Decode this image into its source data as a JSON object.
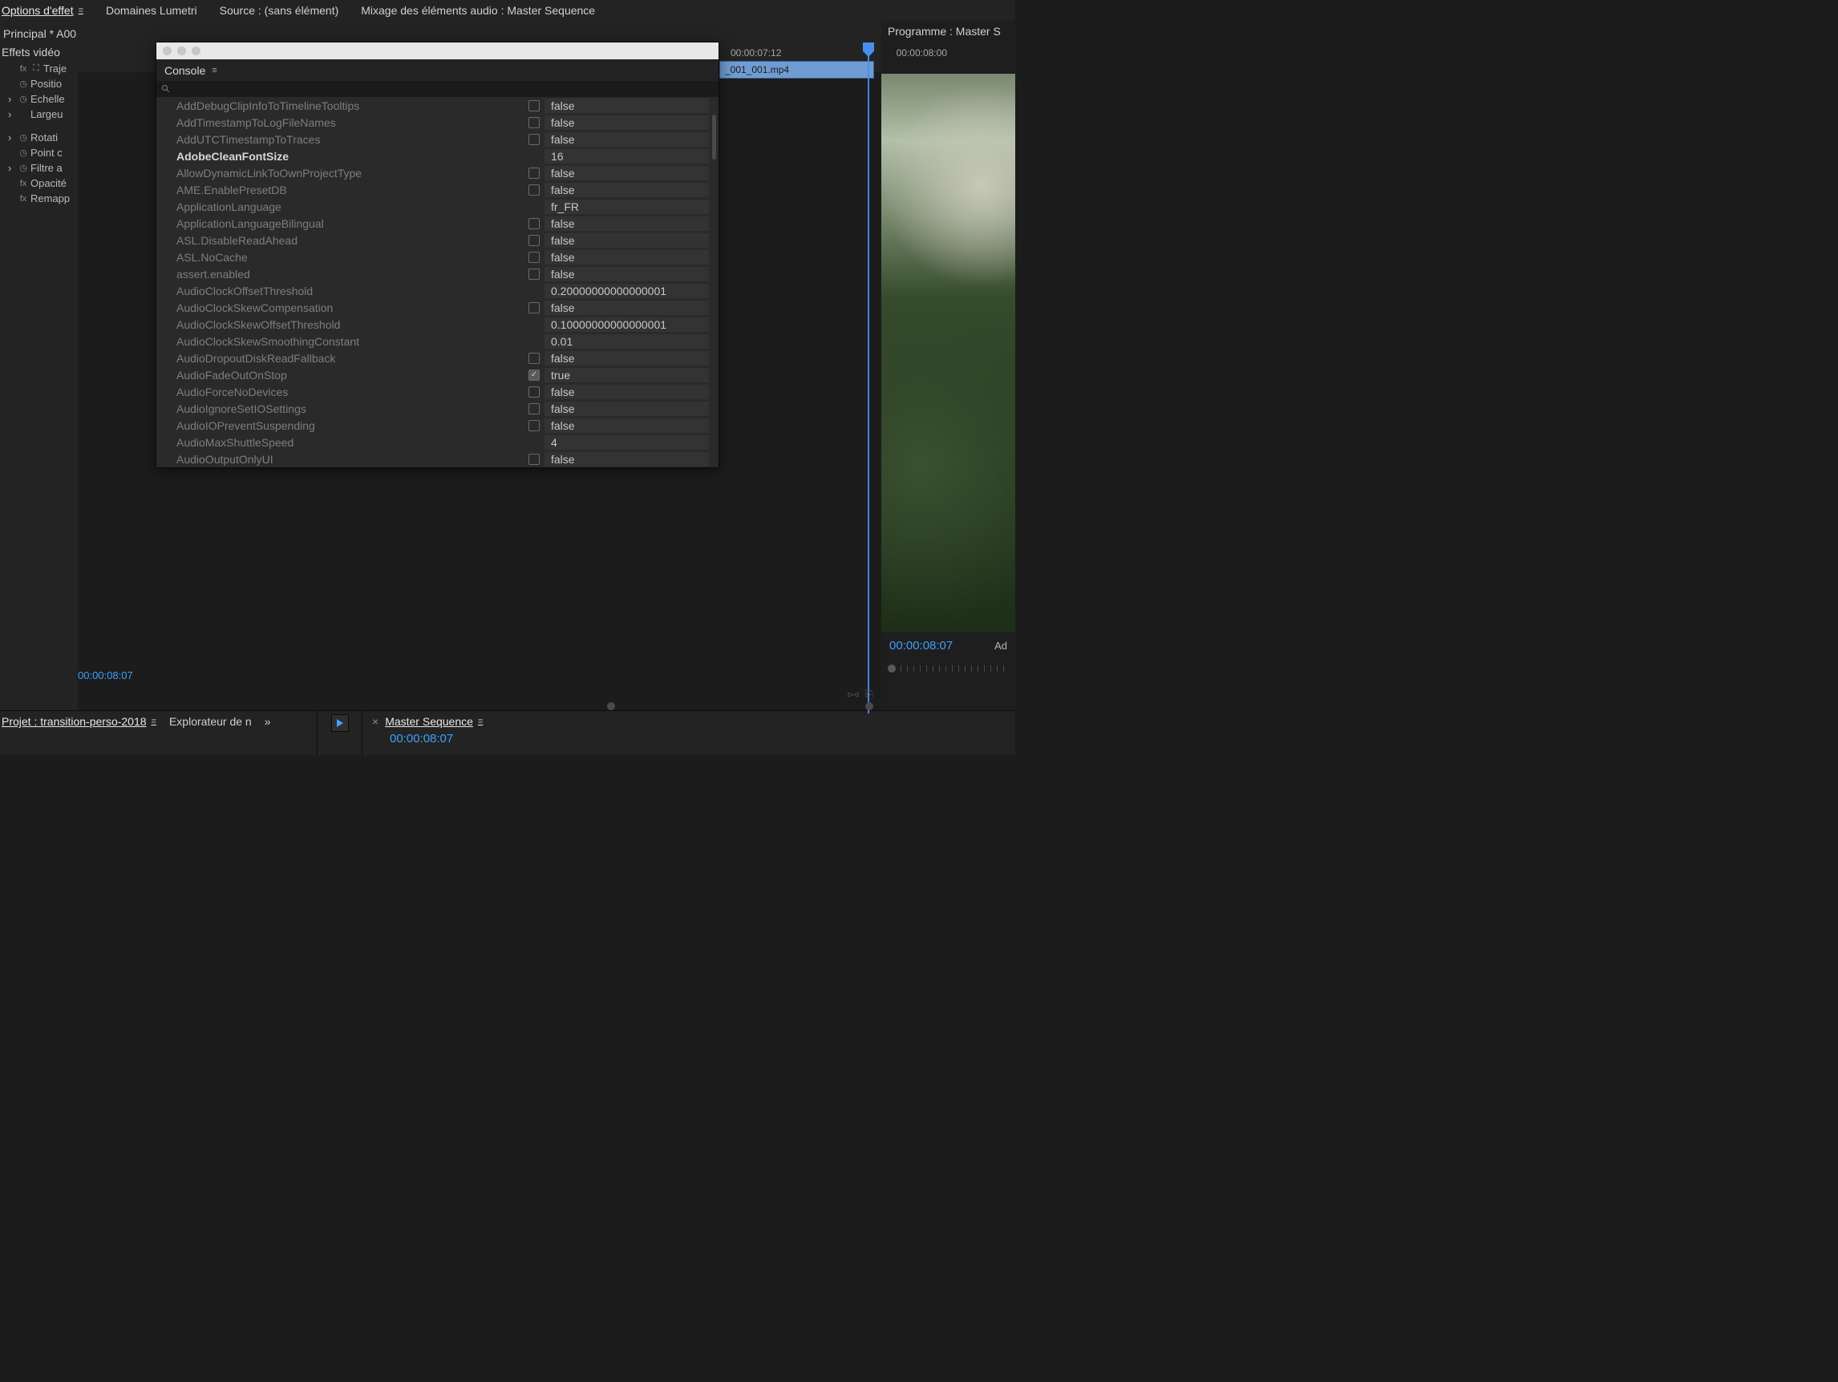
{
  "topTabs": {
    "options": "Options d'effet",
    "lumetri": "Domaines Lumetri",
    "source": "Source : (sans élément)",
    "mixage": "Mixage des éléments audio : Master Sequence",
    "programme": "Programme : Master S"
  },
  "principal": "Principal * A00",
  "effets": {
    "header": "Effets vidéo",
    "items": {
      "trajectoire": "Traje",
      "position": "Positio",
      "echelle": "Echelle",
      "largeur": "Largeu",
      "rotation": "Rotati",
      "pointc": "Point c",
      "filtre": "Filtre a",
      "opacite": "Opacité",
      "remapp": "Remapp"
    }
  },
  "timeline": {
    "tc1": "00:00:07:12",
    "tc2": "00:00:08:00",
    "clipName": "_001_001.mp4",
    "currentTC": "00:00:08:07"
  },
  "console": {
    "title": "Console",
    "rows": [
      {
        "name": "AddDebugClipInfoToTimelineTooltips",
        "chk": true,
        "val": "false"
      },
      {
        "name": "AddTimestampToLogFileNames",
        "chk": true,
        "val": "false"
      },
      {
        "name": "AddUTCTimestampToTraces",
        "chk": true,
        "val": "false"
      },
      {
        "name": "AdobeCleanFontSize",
        "emph": true,
        "val": "16"
      },
      {
        "name": "AllowDynamicLinkToOwnProjectType",
        "chk": true,
        "val": "false"
      },
      {
        "name": "AME.EnablePresetDB",
        "chk": true,
        "val": "false"
      },
      {
        "name": "ApplicationLanguage",
        "val": "fr_FR"
      },
      {
        "name": "ApplicationLanguageBilingual",
        "chk": true,
        "val": "false"
      },
      {
        "name": "ASL.DisableReadAhead",
        "chk": true,
        "val": "false"
      },
      {
        "name": "ASL.NoCache",
        "chk": true,
        "val": "false"
      },
      {
        "name": "assert.enabled",
        "chk": true,
        "val": "false"
      },
      {
        "name": "AudioClockOffsetThreshold",
        "val": "0.20000000000000001"
      },
      {
        "name": "AudioClockSkewCompensation",
        "chk": true,
        "val": "false"
      },
      {
        "name": "AudioClockSkewOffsetThreshold",
        "val": "0.10000000000000001"
      },
      {
        "name": "AudioClockSkewSmoothingConstant",
        "val": "0.01"
      },
      {
        "name": "AudioDropoutDiskReadFallback",
        "chk": true,
        "val": "false"
      },
      {
        "name": "AudioFadeOutOnStop",
        "chk": true,
        "checked": true,
        "val": "true"
      },
      {
        "name": "AudioForceNoDevices",
        "chk": true,
        "val": "false"
      },
      {
        "name": "AudioIgnoreSetIOSettings",
        "chk": true,
        "val": "false"
      },
      {
        "name": "AudioIOPreventSuspending",
        "chk": true,
        "val": "false"
      },
      {
        "name": "AudioMaxShuttleSpeed",
        "val": "4"
      },
      {
        "name": "AudioOutputOnlyUI",
        "chk": true,
        "val": "false"
      }
    ]
  },
  "bottom": {
    "project": "Projet : transition-perso-2018",
    "explorer": "Explorateur de n",
    "overflow": "»",
    "masterSeq": "Master Sequence",
    "close": "×",
    "tcBlue": "00:00:08:07"
  },
  "program": {
    "tc": "00:00:08:07",
    "ajust": "Ad"
  }
}
